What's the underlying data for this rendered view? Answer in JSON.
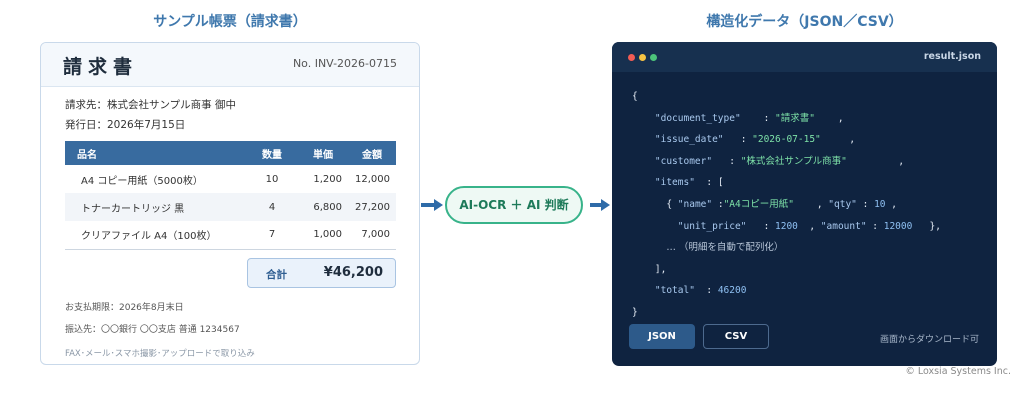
{
  "headings": {
    "left": "サンプル帳票（請求書）",
    "right": "構造化データ（JSON／CSV）"
  },
  "invoice": {
    "title": "請求書",
    "number": "No. INV-2026-0715",
    "customer_line": "請求先：株式会社サンプル商事 御中",
    "date_line": "発行日：2026年7月15日",
    "columns": [
      "品名",
      "数量",
      "単価",
      "金額"
    ],
    "rows": [
      [
        "A4 コピー用紙（5000枚）",
        "10",
        "1,200",
        "12,000"
      ],
      [
        "トナーカートリッジ 黒",
        "4",
        "6,800",
        "27,200"
      ],
      [
        "クリアファイル A4（100枚）",
        "7",
        "1,000",
        "7,000"
      ]
    ],
    "total_label": "合計",
    "total_value": "¥46,200",
    "due_line": "お支払期限：2026年8月末日",
    "bank_line": "振込先：〇〇銀行 〇〇支店 普通 1234567",
    "note": "FAX･メール･スマホ撮影･アップロードで取り込み"
  },
  "process": {
    "label": "AI-OCR ＋ AI 判断"
  },
  "json_panel": {
    "filename": "result.json",
    "lines": {
      "open": "{",
      "document_type_key": "\"document_type\"",
      "document_type_val": "\"請求書\"",
      "issue_date_key": "\"issue_date\"",
      "issue_date_val": "\"2026-07-15\"",
      "customer_key": "\"customer\"",
      "customer_val": "\"株式会社サンプル商事\"",
      "items_key": "\"items\"",
      "name_key": "\"name\"",
      "name_val": "\"A4コピー用紙\"",
      "qty_key": "\"qty\"",
      "qty_val": "10",
      "unit_price_key": "\"unit_price\"",
      "unit_price_val": "1200",
      "amount_key": "\"amount\"",
      "amount_val": "12000",
      "comment": "… （明細を自動で配列化）",
      "items_close": "],",
      "total_key": "\"total\"",
      "total_val": "46200",
      "close": "}"
    },
    "tabs": [
      "JSON",
      "CSV"
    ],
    "hint": "画面からダウンロード可"
  },
  "copyright": "© Loxsia Systems Inc.",
  "colors": {
    "accent": "#3f78ad",
    "table_header": "#386b9f",
    "panel_bg": "#0f2340",
    "ai_green": "#38b38a",
    "dot_red": "#f25c54",
    "dot_yellow": "#f6c343",
    "dot_green": "#4cc47a"
  }
}
